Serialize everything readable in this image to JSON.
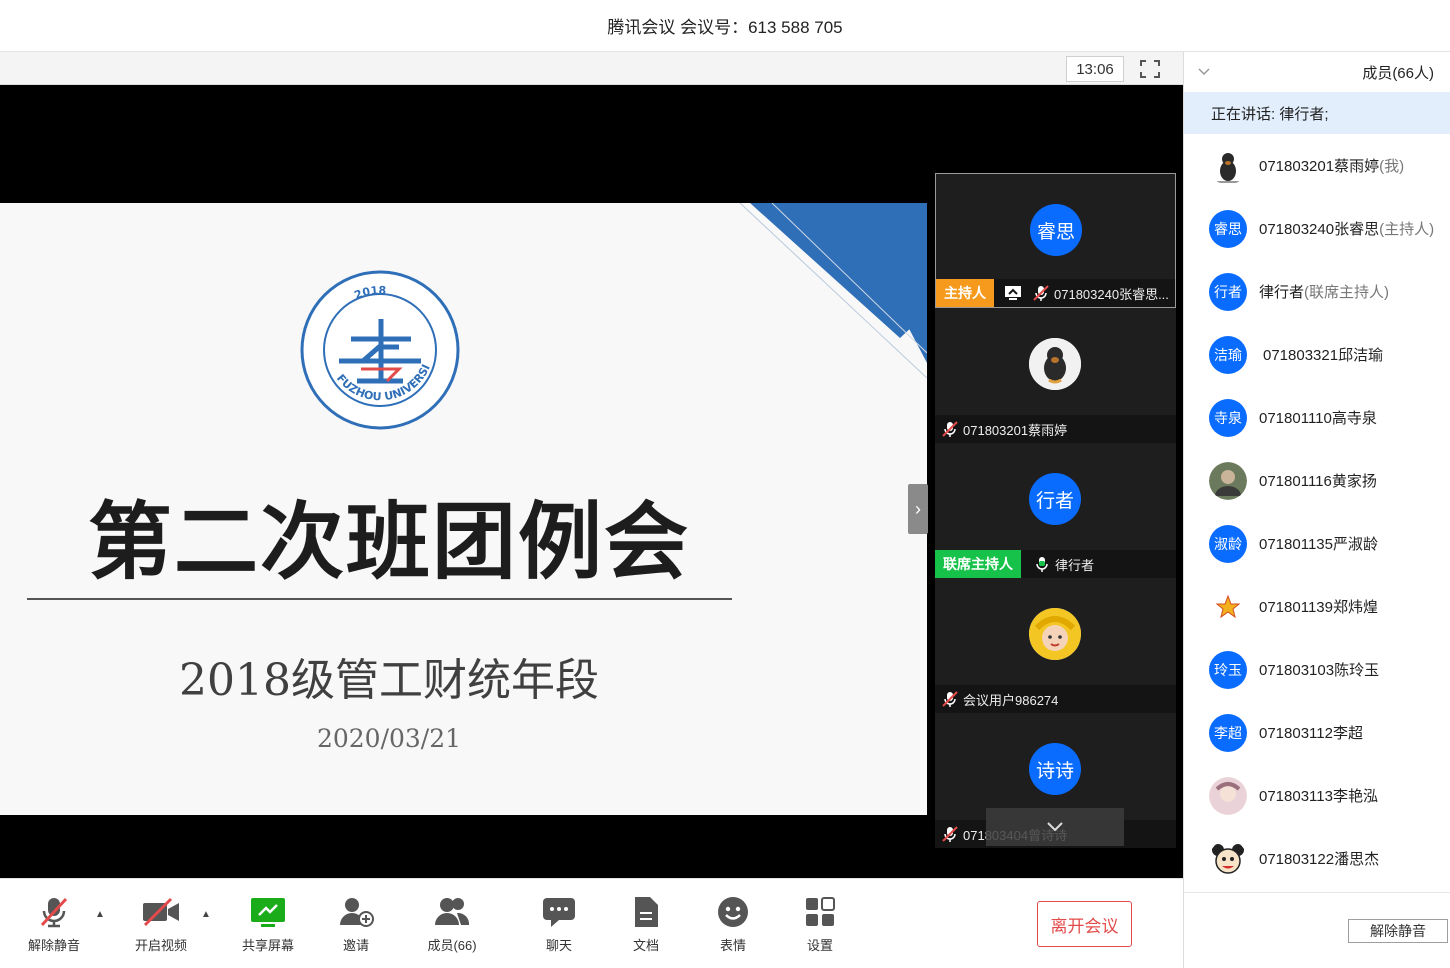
{
  "window": {
    "title": "腾讯会议 会议号：613 588 705"
  },
  "stage": {
    "time": "13:06"
  },
  "slide": {
    "title": "第二次班团例会",
    "subtitle": "2018级管工财统年段",
    "date": "2020/03/21",
    "logo": {
      "ring_text": "FUZHOU UNIVERSITY",
      "center_glyph": "2018"
    }
  },
  "tiles": [
    {
      "avatar_text": "睿思",
      "tag": "主持人",
      "name": "071803240张睿思..."
    },
    {
      "avatar_text": "",
      "name": "071803201蔡雨婷"
    },
    {
      "avatar_text": "行者",
      "tag": "联席主持人",
      "name": "律行者"
    },
    {
      "avatar_text": "",
      "name": "会议用户986274"
    },
    {
      "avatar_text": "诗诗",
      "name": "071803404曾诗诗"
    }
  ],
  "toolbar": {
    "unmute": "解除静音",
    "video": "开启视频",
    "share": "共享屏幕",
    "invite": "邀请",
    "members": "成员(66)",
    "chat": "聊天",
    "docs": "文档",
    "emoji": "表情",
    "settings": "设置",
    "leave": "离开会议"
  },
  "panel": {
    "title": "成员(66人)",
    "speaking": "正在讲话: 律行者;",
    "unmute_all": "解除静音",
    "members": [
      {
        "avatar_text": "",
        "name": "071803201蔡雨婷",
        "role": "(我)"
      },
      {
        "avatar_text": "睿思",
        "name": "071803240张睿思",
        "role": "(主持人)"
      },
      {
        "avatar_text": "行者",
        "name": "律行者",
        "role": "(联席主持人)"
      },
      {
        "avatar_text": "洁瑜",
        "name": "071803321邱洁瑜",
        "role": ""
      },
      {
        "avatar_text": "寺泉",
        "name": "071801110高寺泉",
        "role": ""
      },
      {
        "avatar_text": "",
        "name": "071801116黄家扬",
        "role": ""
      },
      {
        "avatar_text": "淑龄",
        "name": "071801135严淑龄",
        "role": ""
      },
      {
        "avatar_text": "",
        "name": "071801139郑炜煌",
        "role": ""
      },
      {
        "avatar_text": "玲玉",
        "name": "071803103陈玲玉",
        "role": ""
      },
      {
        "avatar_text": "李超",
        "name": "071803112李超",
        "role": ""
      },
      {
        "avatar_text": "",
        "name": "071803113李艳泓",
        "role": ""
      },
      {
        "avatar_text": "",
        "name": "071803122潘思杰",
        "role": ""
      }
    ]
  },
  "colors": {
    "accent": "#0a6cff",
    "host_tag": "#f59a1c",
    "cohost_tag": "#17c24a",
    "leave": "#e34b4b",
    "share": "#1aad19"
  }
}
